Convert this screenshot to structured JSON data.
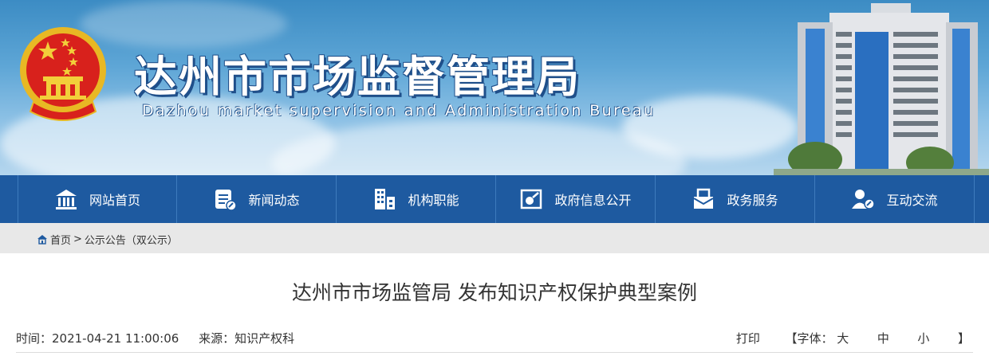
{
  "banner": {
    "title": "达州市市场监督管理局",
    "subtitle": "Dazhou market supervision and Administration Bureau"
  },
  "nav": [
    {
      "label": "网站首页",
      "icon": "home-icon"
    },
    {
      "label": "新闻动态",
      "icon": "news-icon"
    },
    {
      "label": "机构职能",
      "icon": "building-icon"
    },
    {
      "label": "政府信息公开",
      "icon": "info-open-icon"
    },
    {
      "label": "政务服务",
      "icon": "service-inbox-icon"
    },
    {
      "label": "互动交流",
      "icon": "interaction-user-icon"
    }
  ],
  "breadcrumb": {
    "home": "首页",
    "separator": ">",
    "current": "公示公告（双公示）"
  },
  "article": {
    "title": "达州市市场监管局 发布知识产权保护典型案例",
    "time": "时间：2021-04-21 11:00:06",
    "source": "来源：知识产权科"
  },
  "tools": {
    "print": "打印",
    "font_open": "【字体：",
    "large": "大",
    "medium": "中",
    "small": "小",
    "font_close": "】"
  },
  "colors": {
    "nav_bg": "#1e5aa0",
    "breadcrumb_bg": "#e8e8e8",
    "title_text": "#333333"
  }
}
